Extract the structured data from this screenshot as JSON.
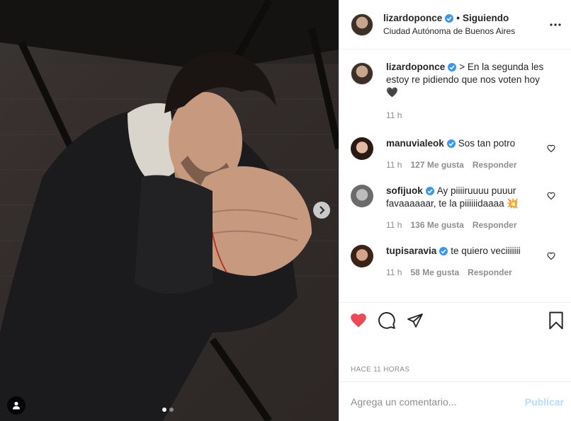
{
  "post": {
    "photo_alt": "",
    "carousel": {
      "count": 2,
      "active": 1
    }
  },
  "header": {
    "username": "lizardoponce",
    "separator": "•",
    "follow_status": "Siguiendo",
    "location": "Ciudad Autónoma de Buenos Aires",
    "more_icon": "more-horizontal-icon"
  },
  "caption": {
    "username": "lizardoponce",
    "text": "> En la segunda les estoy re pidiendo que nos voten hoy 🖤",
    "time": "11 h"
  },
  "comments": [
    {
      "username": "manuvialeok",
      "text": "Sos tan potro",
      "time": "11 h",
      "likes": "127 Me gusta",
      "reply": "Responder"
    },
    {
      "username": "sofijuok",
      "text": "Ay piiiiruuuu puuur favaaaaaar, te la piiiiiidaaaa 💥",
      "time": "11 h",
      "likes": "136 Me gusta",
      "reply": "Responder"
    },
    {
      "username": "tupisaravia",
      "text": "te quiero veciiiiiii",
      "time": "11 h",
      "likes": "58 Me gusta",
      "reply": "Responder"
    }
  ],
  "actions": {
    "liked": true,
    "like_color": "#ed4956",
    "time_ago": "HACE 11 HORAS"
  },
  "composer": {
    "placeholder": "Agrega un comentario...",
    "post_label": "Publicar",
    "post_color": "#b2dffc"
  },
  "colors": {
    "verified": "#3897f0",
    "muted": "#8e8e8e",
    "text": "#262626"
  }
}
